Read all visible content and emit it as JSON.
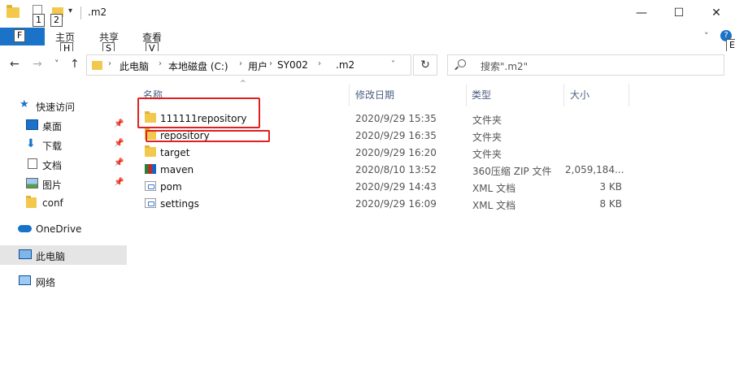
{
  "window": {
    "title": ".m2",
    "keytips": [
      "1",
      "2"
    ],
    "controls": {
      "minimize": "—",
      "maximize": "☐",
      "close": "✕"
    }
  },
  "ribbon": {
    "file_keytip": "F",
    "tabs": [
      {
        "label": "主页",
        "keytip": "H"
      },
      {
        "label": "共享",
        "keytip": "S"
      },
      {
        "label": "查看",
        "keytip": "V"
      }
    ],
    "expand_keytip": "E",
    "help": "?"
  },
  "address": {
    "back": "←",
    "forward": "→",
    "recent": "˅",
    "up": "↑",
    "crumbs": [
      "此电脑",
      "本地磁盘 (C:)",
      "用户",
      "SY002",
      ".m2"
    ],
    "refresh": "↻"
  },
  "search": {
    "placeholder": "搜索\".m2\""
  },
  "nav_pane": {
    "items": [
      {
        "label": "快速访问",
        "icon": "star-icon"
      },
      {
        "label": "桌面",
        "icon": "desktop-icon",
        "pinned": true
      },
      {
        "label": "下载",
        "icon": "download-icon",
        "pinned": true
      },
      {
        "label": "文档",
        "icon": "documents-icon",
        "pinned": true
      },
      {
        "label": "图片",
        "icon": "pictures-icon",
        "pinned": true
      },
      {
        "label": "conf",
        "icon": "folder-icon"
      },
      {
        "label": "OneDrive",
        "icon": "onedrive-icon"
      },
      {
        "label": "此电脑",
        "icon": "pc-icon",
        "selected": true
      },
      {
        "label": "网络",
        "icon": "network-icon"
      }
    ]
  },
  "file_list": {
    "columns": [
      "名称",
      "修改日期",
      "类型",
      "大小"
    ],
    "rows": [
      {
        "name": "111111repository",
        "date": "2020/9/29 15:35",
        "type": "文件夹",
        "size": "",
        "icon": "folder-icon"
      },
      {
        "name": "repository",
        "date": "2020/9/29 16:35",
        "type": "文件夹",
        "size": "",
        "icon": "folder-icon"
      },
      {
        "name": "target",
        "date": "2020/9/29 16:20",
        "type": "文件夹",
        "size": "",
        "icon": "folder-icon"
      },
      {
        "name": "maven",
        "date": "2020/8/10 13:52",
        "type": "360压缩 ZIP 文件",
        "size": "2,059,184...",
        "icon": "zip-icon"
      },
      {
        "name": "pom",
        "date": "2020/9/29 14:43",
        "type": "XML 文档",
        "size": "3 KB",
        "icon": "xml-icon"
      },
      {
        "name": "settings",
        "date": "2020/9/29 16:09",
        "type": "XML 文档",
        "size": "8 KB",
        "icon": "xml-icon"
      }
    ]
  },
  "colors": {
    "accent": "#1a73c9",
    "highlight": "#e02020",
    "folder": "#f2c94c"
  }
}
